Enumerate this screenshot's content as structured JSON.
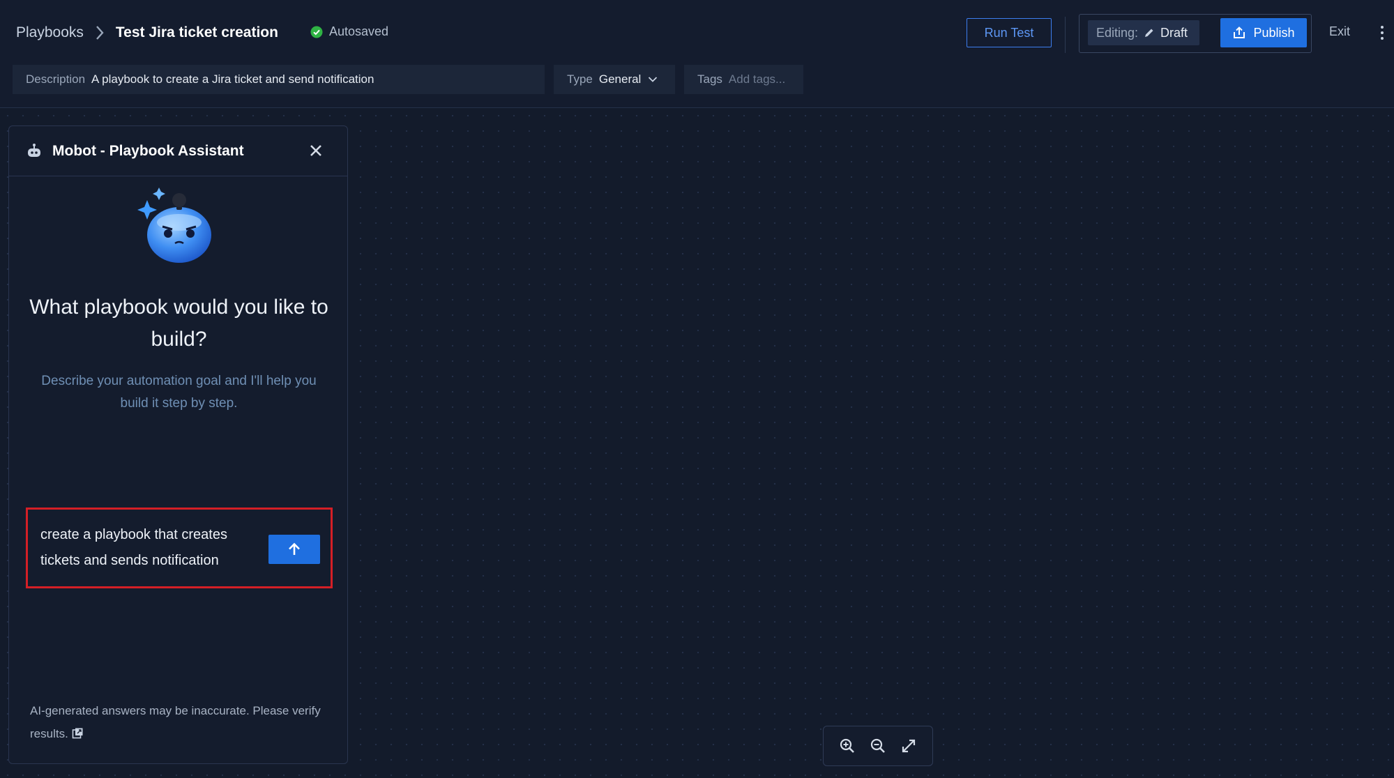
{
  "header": {
    "breadcrumb_root": "Playbooks",
    "breadcrumb_current": "Test Jira ticket creation",
    "autosave_status": "Autosaved",
    "run_test_label": "Run Test",
    "editing_label": "Editing:",
    "editing_state": "Draft",
    "publish_label": "Publish",
    "exit_label": "Exit"
  },
  "fields": {
    "description_label": "Description",
    "description_value": "A playbook to create a Jira ticket and send notification",
    "type_label": "Type",
    "type_value": "General",
    "tags_label": "Tags",
    "tags_placeholder": "Add tags..."
  },
  "assistant": {
    "title": "Mobot - Playbook Assistant",
    "headline": "What playbook would you like to build?",
    "subline": "Describe your automation goal and I'll help you build it step by step.",
    "prompt_value": "create a playbook that creates tickets and sends notification",
    "disclaimer": "AI-generated answers may be inaccurate. Please verify results."
  },
  "icons": {
    "autosave": "check-circle-icon",
    "pencil": "pencil-icon",
    "publish": "upload-icon",
    "more": "kebab-menu-icon",
    "bot": "robot-icon",
    "close": "close-icon",
    "send": "arrow-up-icon",
    "external": "external-link-icon",
    "zoom_in": "zoom-in-icon",
    "zoom_out": "zoom-out-icon",
    "fit": "expand-icon"
  },
  "colors": {
    "accent": "#1f6fe0",
    "success": "#2fb344",
    "highlight_border": "#d41f26",
    "background": "#141c2e"
  }
}
